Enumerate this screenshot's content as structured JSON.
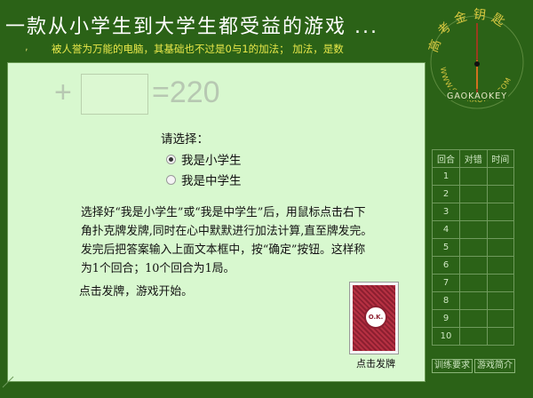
{
  "header": {
    "title": "一款从小学生到大学生都受益的游戏 ...",
    "ticker": "被人誉为万能的电脑，其基础也不过是0与1的加法；      加法，是数",
    "ticker_dot": ","
  },
  "equation": {
    "plus": "+",
    "answer_value": "",
    "result": "=220"
  },
  "choice": {
    "prompt": "请选择：",
    "options": [
      {
        "label": "我是小学生",
        "selected": true
      },
      {
        "label": "我是中学生",
        "selected": false
      }
    ]
  },
  "instructions": {
    "text": "选择好“我是小学生”或“我是中学生”后，用鼠标点击右下角扑克牌发牌,同时在心中默默进行加法计算,直至牌发完。发完后把答案输入上面文本框中，按“确定”按钮。这样称为1个回合；10个回合为1局。",
    "start": "点击发牌，游戏开始。"
  },
  "card": {
    "logo_text": "O.K.",
    "label": "点击发牌"
  },
  "brand": {
    "top_text": "高考金钥匙",
    "bottom_text": "WWW.GAOKAOKEY.COM",
    "mid_text": "GAOKAOKEY"
  },
  "stats": {
    "headers": [
      "回合",
      "对错",
      "时间"
    ],
    "rows": [
      "1",
      "2",
      "3",
      "4",
      "5",
      "6",
      "7",
      "8",
      "9",
      "10"
    ]
  },
  "footer": {
    "requirements_label": "训练要求",
    "intro_label": "游戏简介"
  },
  "colors": {
    "background": "#2b6217",
    "panel": "#d8f8cf",
    "ticker": "#e8e84a",
    "card": "#a4283a"
  }
}
